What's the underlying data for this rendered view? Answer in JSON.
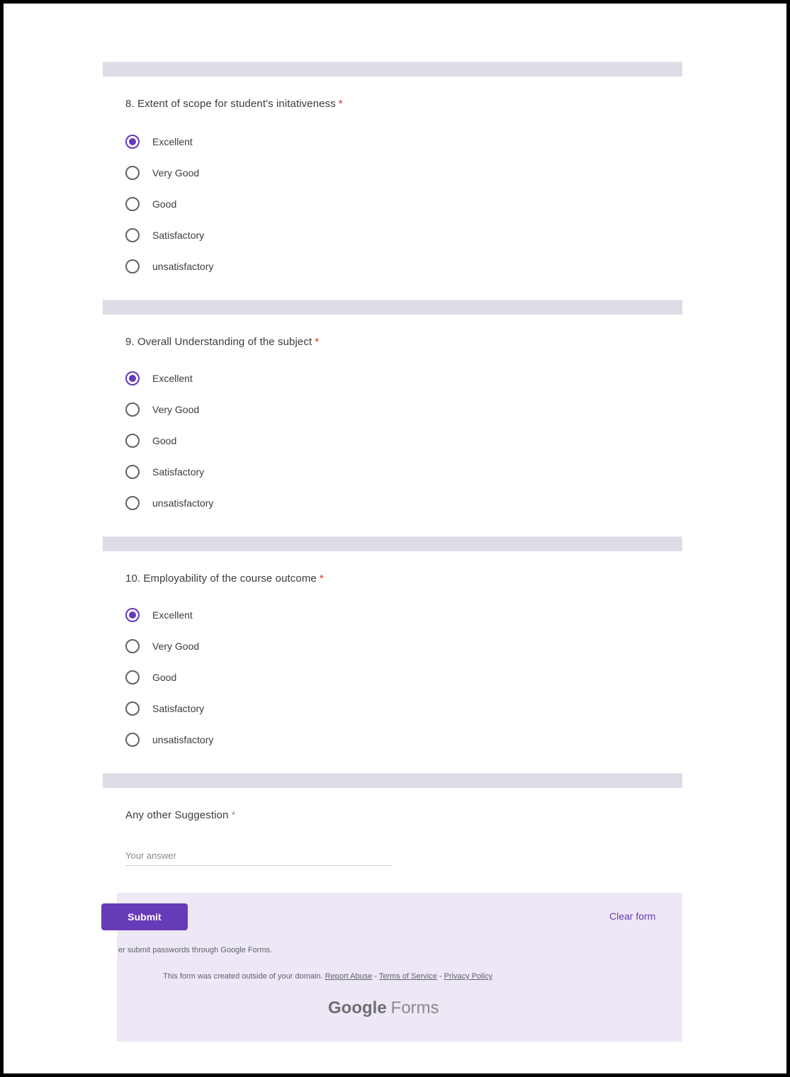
{
  "questions": [
    {
      "title": "8. Extent of scope for student's initativeness",
      "required": "*",
      "options": [
        "Excellent",
        "Very Good",
        "Good",
        "Satisfactory",
        "unsatisfactory"
      ],
      "selected": "Excellent"
    },
    {
      "title": "9. Overall Understanding of the subject",
      "required": "*",
      "options": [
        "Excellent",
        "Very Good",
        "Good",
        "Satisfactory",
        "unsatisfactory"
      ],
      "selected": "Excellent"
    },
    {
      "title": "10. Employability of the course outcome",
      "required": "*",
      "options": [
        "Excellent",
        "Very Good",
        "Good",
        "Satisfactory",
        "unsatisfactory"
      ],
      "selected": "Excellent"
    }
  ],
  "suggestion": {
    "title": "Any other Suggestion",
    "required": "*",
    "placeholder": "Your answer"
  },
  "footer": {
    "submit_label": "Submit",
    "clear_label": "Clear form",
    "warning": "er submit passwords through Google Forms.",
    "domain_notice": "This form was created outside of your domain.",
    "report_abuse": "Report Abuse",
    "terms": "Terms of Service",
    "privacy": "Privacy Policy",
    "separator": " - ",
    "brand_google": "Google",
    "brand_forms": "Forms"
  },
  "colors": {
    "accent": "#673ab7",
    "required": "#d93025",
    "footer_bg": "#ede7f6"
  }
}
